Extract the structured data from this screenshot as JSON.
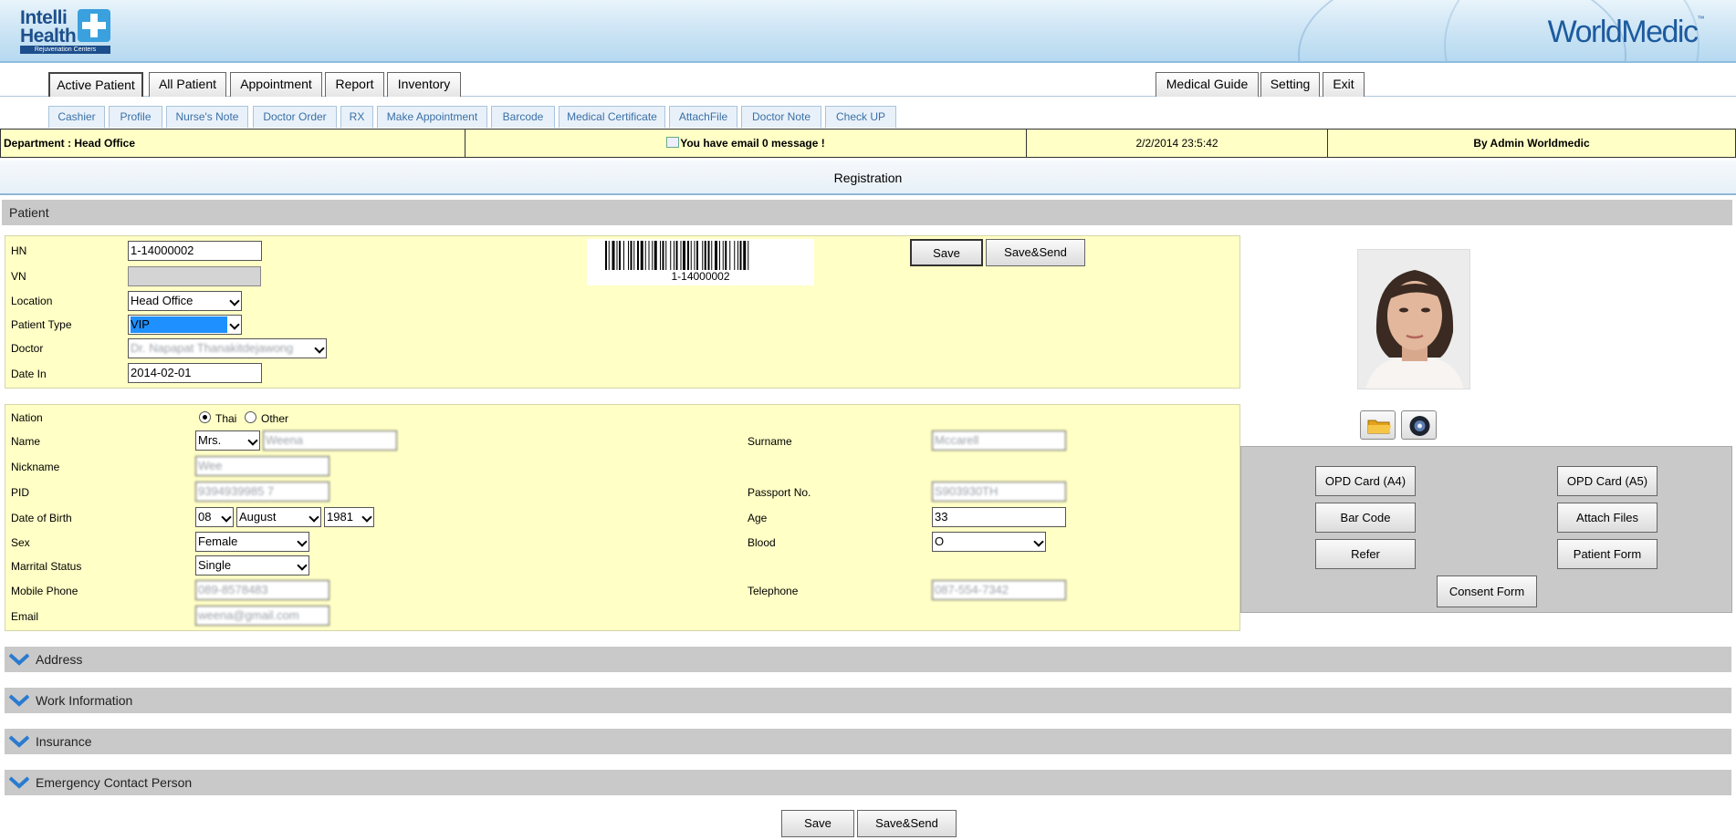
{
  "header": {
    "logo_line1": "Intelli",
    "logo_line2": "Health",
    "logo_sub": "Rejuvenation Centers",
    "brand": "WorldMedic",
    "brand_mark": "™"
  },
  "main_menu": {
    "left": [
      "Active Patient",
      "All Patient",
      "Appointment",
      "Report",
      "Inventory"
    ],
    "right": [
      "Medical Guide",
      "Setting",
      "Exit"
    ]
  },
  "sub_menu": [
    "Cashier",
    "Profile",
    "Nurse's Note",
    "Doctor Order",
    "RX",
    "Make Appointment",
    "Barcode",
    "Medical Certificate",
    "AttachFile",
    "Doctor Note",
    "Check UP"
  ],
  "info_bar": {
    "department": "Department : Head Office",
    "email_message": "You have email 0 message !",
    "datetime": "2/2/2014 23:5:42",
    "user": "By Admin Worldmedic"
  },
  "page_title": "Registration",
  "patient_section": {
    "title": "Patient",
    "hn_label": "HN",
    "hn_value": "1-14000002",
    "vn_label": "VN",
    "vn_value": "",
    "location_label": "Location",
    "location_value": "Head Office",
    "patient_type_label": "Patient Type",
    "patient_type_value": "VIP",
    "doctor_label": "Doctor",
    "doctor_value": "Dr. Napapat Thanakitdejawong",
    "date_in_label": "Date In",
    "date_in_value": "2014-02-01",
    "barcode_text": "1-14000002",
    "save_label": "Save",
    "save_send_label": "Save&Send"
  },
  "details": {
    "nation_label": "Nation",
    "nation_thai": "Thai",
    "nation_other": "Other",
    "nation_selected": "Thai",
    "name_label": "Name",
    "title_value": "Mrs.",
    "name_value": "Weena",
    "surname_label": "Surname",
    "surname_value": "Mccarell",
    "nickname_label": "Nickname",
    "nickname_value": "Wee",
    "pid_label": "PID",
    "pid_value": "9394939985 7",
    "passport_label": "Passport No.",
    "passport_value": "S903930TH",
    "dob_label": "Date of Birth",
    "dob_day": "08",
    "dob_month": "August",
    "dob_year": "1981",
    "age_label": "Age",
    "age_value": "33",
    "sex_label": "Sex",
    "sex_value": "Female",
    "blood_label": "Blood",
    "blood_value": "O",
    "marital_label": "Marrital Status",
    "marital_value": "Single",
    "mobile_label": "Mobile Phone",
    "mobile_value": "089-8578483",
    "telephone_label": "Telephone",
    "telephone_value": "087-554-7342",
    "email_label": "Email",
    "email_value": "weena@gmail.com"
  },
  "photo_tools": {
    "folder_icon": "folder-icon",
    "camera_icon": "camera-icon"
  },
  "print_buttons": {
    "opd_a4": "OPD Card (A4)",
    "opd_a5": "OPD Card (A5)",
    "barcode": "Bar Code",
    "attach_files": "Attach Files",
    "refer": "Refer",
    "patient_form": "Patient Form",
    "consent_form": "Consent Form"
  },
  "sections": {
    "address": "Address",
    "work": "Work Information",
    "insurance": "Insurance",
    "emergency": "Emergency Contact Person"
  },
  "footer": {
    "save_label": "Save",
    "save_send_label": "Save&Send"
  },
  "colors": {
    "panel_bg": "#ffffc6",
    "section_bg": "#c9c9c9",
    "link_blue": "#3b6fa6",
    "select_highlight": "#1e90ff"
  }
}
